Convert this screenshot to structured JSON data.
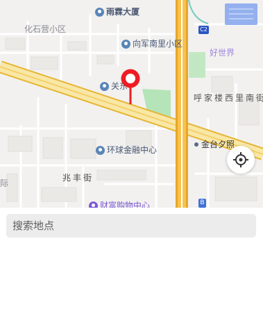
{
  "map": {
    "pois": [
      {
        "name": "雨霖大厦",
        "color": "#5a6a86"
      },
      {
        "name": "向军南里小区",
        "color": "#4a5a78"
      },
      {
        "name": "环球金融中心",
        "color": "#4a5a78"
      },
      {
        "name": "财富购物中心",
        "color": "#7d5ad6"
      },
      {
        "name": "关东",
        "color": "#5a6a86"
      }
    ],
    "labels": {
      "district_left": "化石营小区",
      "district_right": "好世界",
      "street_right": "呼家楼西里南街",
      "street_left": "兆丰街",
      "metro": "金台夕照",
      "edge_fragment": "际"
    },
    "badges": {
      "ring_road": "C2",
      "bus_stop": "B"
    }
  },
  "marker": {
    "color": "#ee1c24"
  },
  "controls": {
    "locate_icon": "crosshair-icon"
  },
  "search": {
    "placeholder": "搜索地点",
    "value": ""
  }
}
